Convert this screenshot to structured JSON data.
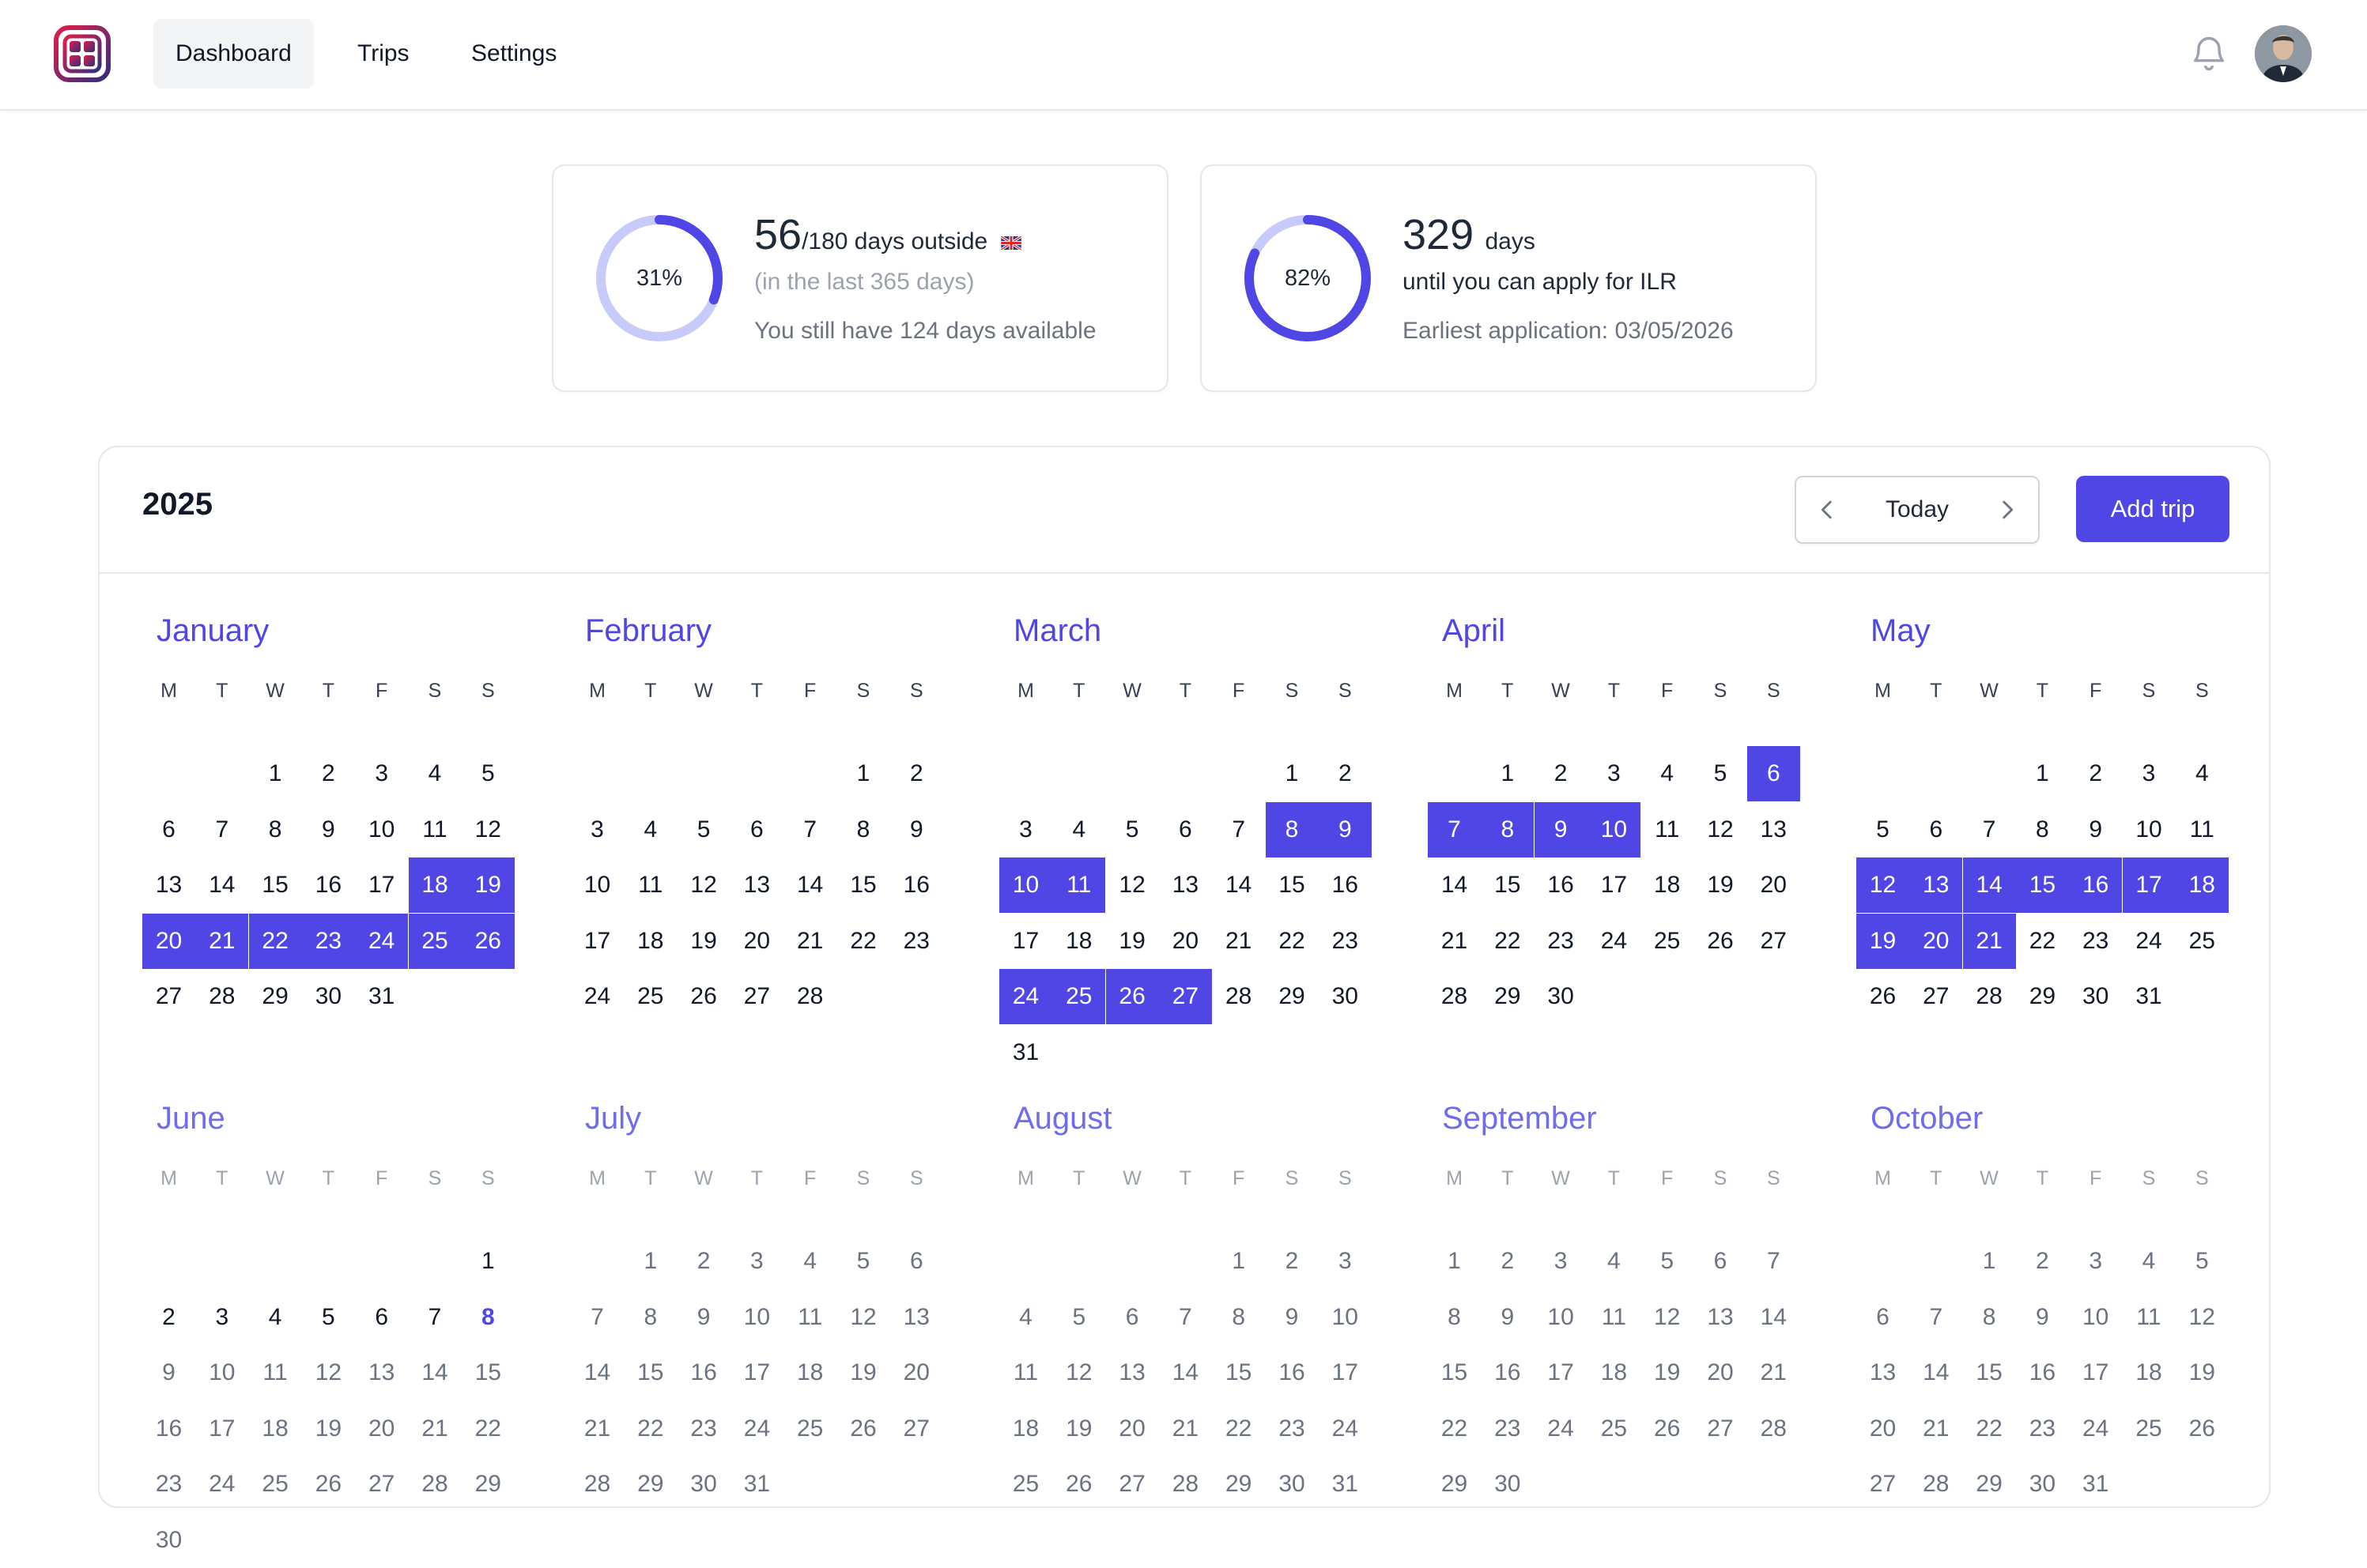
{
  "nav": {
    "items": [
      {
        "label": "Dashboard",
        "active": true
      },
      {
        "label": "Trips",
        "active": false
      },
      {
        "label": "Settings",
        "active": false
      }
    ],
    "icons": {
      "logo": "app-logo-icon",
      "notifications": "bell-icon"
    }
  },
  "stats": {
    "outside": {
      "percent_label": "31%",
      "progress": 0.31,
      "days": "56",
      "limit_text": "/180 days outside",
      "flag": "UK",
      "window_text": "(in the last 365 days)",
      "available_text": "You still have 124 days available"
    },
    "ilr": {
      "percent_label": "82%",
      "progress": 0.82,
      "days": "329",
      "days_unit": "days",
      "until_text": "until you can apply for ILR",
      "earliest_text": "Earliest application: 03/05/2026"
    }
  },
  "calendar": {
    "year": "2025",
    "today_label": "Today",
    "add_trip_label": "Add trip",
    "weekdays": [
      "M",
      "T",
      "W",
      "T",
      "F",
      "S",
      "S"
    ],
    "colors": {
      "accent": "#4f46e5",
      "future_text": "#6b7280"
    },
    "months": [
      {
        "name": "January",
        "start": 2,
        "days": 31,
        "trips": [
          18,
          19,
          20,
          21,
          22,
          23,
          24,
          25,
          26
        ],
        "future": false
      },
      {
        "name": "February",
        "start": 5,
        "days": 28,
        "trips": [],
        "future": false
      },
      {
        "name": "March",
        "start": 5,
        "days": 31,
        "trips": [
          8,
          9,
          10,
          11,
          24,
          25,
          26,
          27
        ],
        "future": false
      },
      {
        "name": "April",
        "start": 1,
        "days": 30,
        "trips": [
          6,
          7,
          8,
          9,
          10
        ],
        "future": false
      },
      {
        "name": "May",
        "start": 3,
        "days": 31,
        "trips": [
          12,
          13,
          14,
          15,
          16,
          17,
          18,
          19,
          20,
          21
        ],
        "future": false
      },
      {
        "name": "June",
        "start": 6,
        "days": 30,
        "trips": [],
        "future": true,
        "past_until": 8,
        "today": 8
      },
      {
        "name": "July",
        "start": 1,
        "days": 31,
        "trips": [],
        "future": true
      },
      {
        "name": "August",
        "start": 4,
        "days": 31,
        "trips": [],
        "future": true
      },
      {
        "name": "September",
        "start": 0,
        "days": 30,
        "trips": [],
        "future": true
      },
      {
        "name": "October",
        "start": 2,
        "days": 31,
        "trips": [],
        "future": true
      }
    ]
  }
}
